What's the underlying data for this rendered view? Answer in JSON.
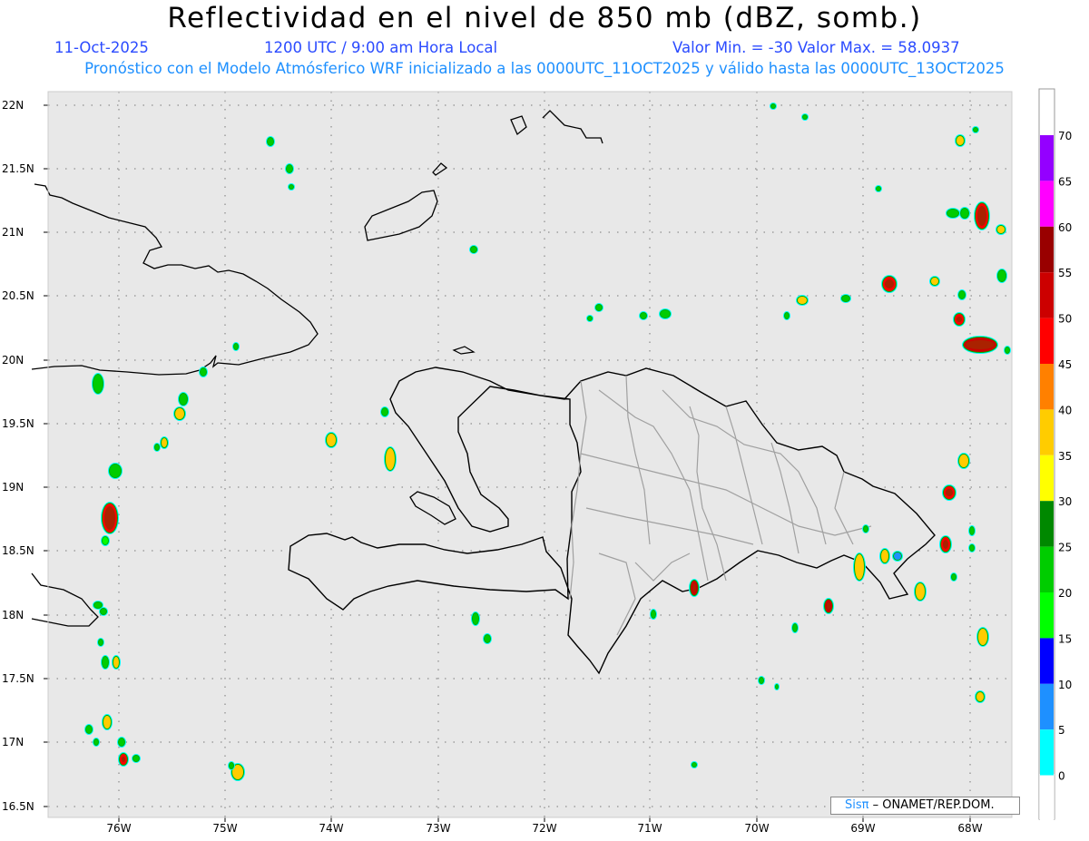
{
  "title": "Reflectividad en el nivel de 850 mb (dBZ, somb.)",
  "header": {
    "date": "11-Oct-2025",
    "time": "1200 UTC / 9:00 am Hora Local",
    "minmax": "Valor Min. = -30  Valor Max. = 58.0937",
    "model": "Pronóstico con el Modelo Atmósferico WRF inicializado a las 0000UTC_11OCT2025 y válido hasta las  0000UTC_13OCT2025"
  },
  "lat_labels": [
    "22N",
    "21.5N",
    "21N",
    "20.5N",
    "20N",
    "19.5N",
    "19N",
    "18.5N",
    "18N",
    "17.5N",
    "17N",
    "16.5N"
  ],
  "lon_labels": [
    "76W",
    "75W",
    "74W",
    "73W",
    "72W",
    "71W",
    "70W",
    "69W",
    "68W"
  ],
  "colorbar": {
    "labels": [
      "70",
      "65",
      "60",
      "55",
      "50",
      "45",
      "40",
      "35",
      "30",
      "25",
      "20",
      "15",
      "10",
      "5",
      "0"
    ],
    "colors": [
      "#9400ff",
      "#ff00ff",
      "#990000",
      "#cc0000",
      "#ff0000",
      "#ff8000",
      "#ffcc00",
      "#ffff00",
      "#008800",
      "#00cc00",
      "#00ff00",
      "#0000ff",
      "#1e90ff",
      "#00ffff",
      "#ffffff"
    ]
  },
  "credit": {
    "brand": "Sisπ",
    "org": "– ONAMET/REP.DOM."
  },
  "colors": {
    "background": "#e8e8e8",
    "grid": "#777777",
    "coast": "#000000",
    "provinces": "#a0a0a0"
  }
}
